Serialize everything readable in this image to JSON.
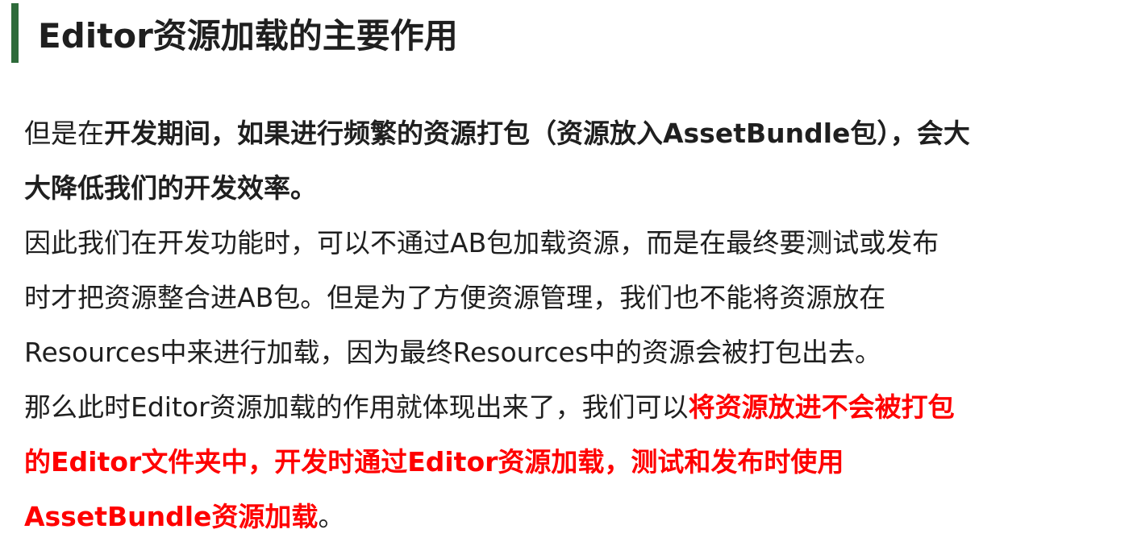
{
  "heading": {
    "title": "Editor资源加载的主要作用",
    "accent_color": "#2e6b3a"
  },
  "paragraphs": {
    "p1": {
      "seg1": "但是在",
      "seg2": "开发期间，如果进行频繁的资源打包（资源放入AssetBundle包），会大",
      "seg3": "大降低我们的开发效率。"
    },
    "p2": {
      "line1": "因此我们在开发功能时，可以不通过AB包加载资源，而是在最终要测试或发布",
      "line2": "时才把资源整合进AB包。但是为了方便资源管理，我们也不能将资源放在",
      "line3": "Resources中来进行加载，因为最终Resources中的资源会被打包出去。"
    },
    "p3": {
      "seg1": "那么此时Editor资源加载的作用就体现出来了，我们可以",
      "seg2": "将资源放进不会被打包",
      "seg3": "的Editor文件夹中，开发时通过Editor资源加载，测试和发布时使用",
      "seg4": "AssetBundle资源加载",
      "seg5": "。"
    }
  },
  "colors": {
    "text": "#1f1f1f",
    "highlight": "#ff0000"
  }
}
